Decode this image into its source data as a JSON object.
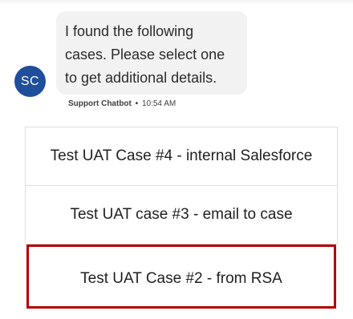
{
  "bot": {
    "avatar_initials": "SC",
    "message": "I found the following cases. Please select one to get additional details.",
    "sender": "Support Chatbot",
    "separator": "•",
    "timestamp": "10:54 AM",
    "avatar_color": "#1f4e9a"
  },
  "options": [
    {
      "label": "Test UAT Case #4 - internal Salesforce"
    },
    {
      "label": "Test UAT case #3 - email to case"
    },
    {
      "label": "Test UAT Case #2 - from RSA"
    }
  ],
  "highlight_color": "#b20000"
}
